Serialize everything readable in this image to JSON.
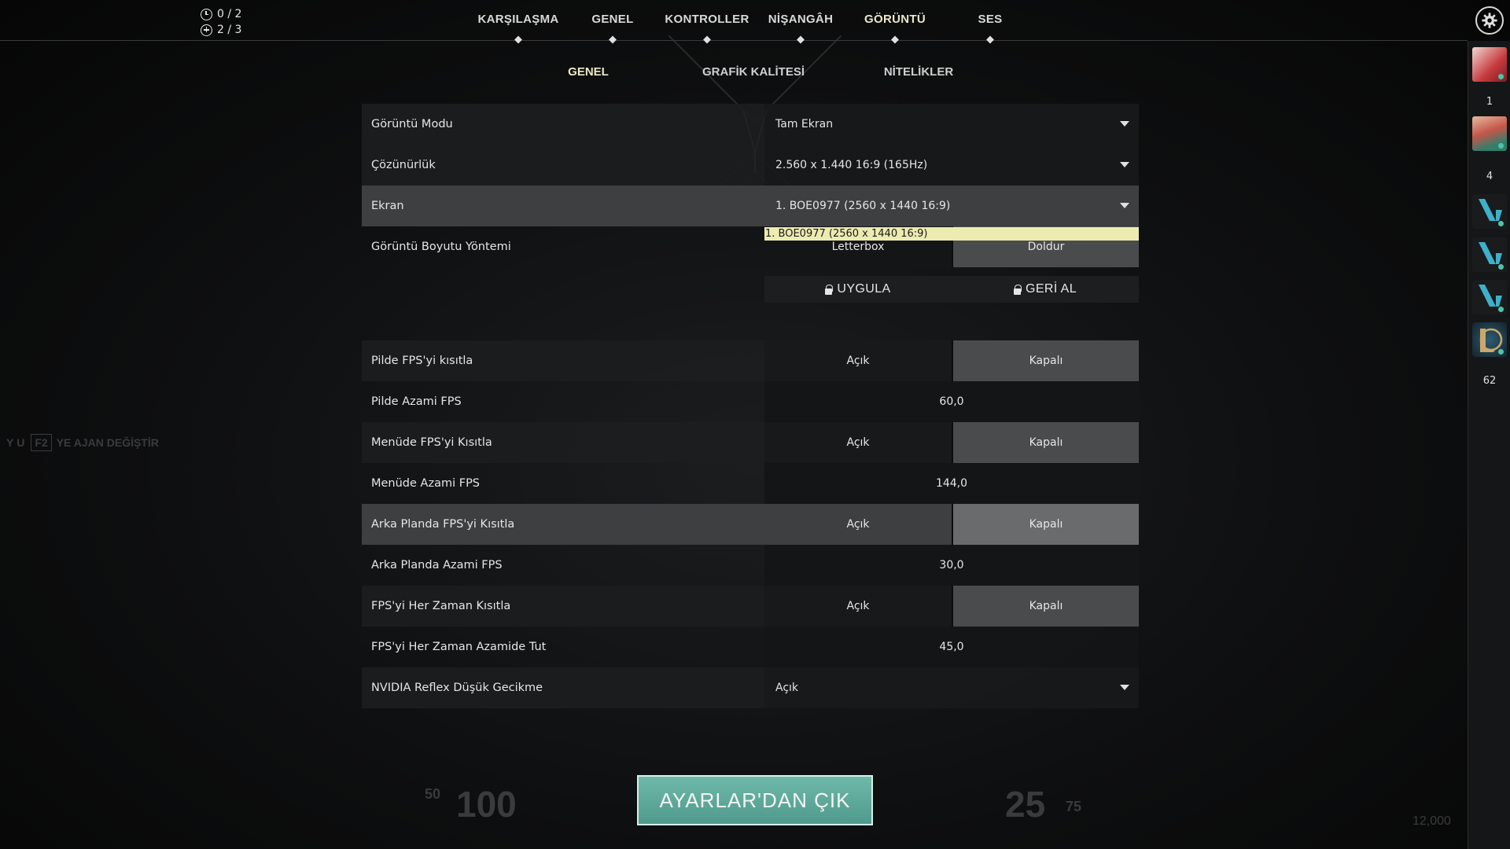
{
  "counters": {
    "timer": "0 / 2",
    "plus": "2 / 3"
  },
  "main_tabs": [
    {
      "label": "KARŞILAŞMA"
    },
    {
      "label": "GENEL"
    },
    {
      "label": "KONTROLLER"
    },
    {
      "label": "NİŞANGÂH"
    },
    {
      "label": "GÖRÜNTÜ",
      "active": true
    },
    {
      "label": "SES"
    }
  ],
  "sub_tabs": [
    {
      "label": "GENEL",
      "active": true
    },
    {
      "label": "GRAFİK KALİTESİ"
    },
    {
      "label": "NİTELİKLER"
    }
  ],
  "sidebar": {
    "counts": [
      "1",
      "4",
      "62"
    ]
  },
  "settings": {
    "display_mode": {
      "label": "Görüntü Modu",
      "value": "Tam Ekran"
    },
    "resolution": {
      "label": "Çözünürlük",
      "value": "2.560 x 1.440 16:9 (165Hz)"
    },
    "monitor": {
      "label": "Ekran",
      "value": "1. BOE0977 (2560 x  1440 16:9)",
      "popup_option": "1. BOE0977 (2560 x  1440 16:9)"
    },
    "aspect_method": {
      "label": "Görüntü Boyutu Yöntemi",
      "opt_a": "Letterbox",
      "opt_b": "Doldur"
    },
    "apply_label": "UYGULA",
    "revert_label": "GERİ AL",
    "limit_fps_battery": {
      "label": "Pilde FPS'yi kısıtla",
      "on": "Açık",
      "off": "Kapalı",
      "selected": "Kapalı"
    },
    "max_fps_battery": {
      "label": "Pilde Azami FPS",
      "value": "60,0"
    },
    "limit_fps_menu": {
      "label": "Menüde FPS'yi Kısıtla",
      "on": "Açık",
      "off": "Kapalı",
      "selected": "Kapalı"
    },
    "max_fps_menu": {
      "label": "Menüde Azami FPS",
      "value": "144,0"
    },
    "limit_fps_background": {
      "label": "Arka Planda FPS'yi Kısıtla",
      "on": "Açık",
      "off": "Kapalı",
      "selected": "Kapalı"
    },
    "max_fps_background": {
      "label": "Arka Planda Azami FPS",
      "value": "30,0"
    },
    "limit_fps_always": {
      "label": "FPS'yi Her Zaman Kısıtla",
      "on": "Açık",
      "off": "Kapalı",
      "selected": "Kapalı"
    },
    "max_fps_always": {
      "label": "FPS'yi Her Zaman Azamide Tut",
      "value": "45,0"
    },
    "nvidia_reflex": {
      "label": "NVIDIA Reflex Düşük Gecikme",
      "value": "Açık"
    }
  },
  "exit_button": {
    "label": "AYARLAR'DAN ÇIK"
  },
  "background_hud": {
    "left_hint": "YE AJAN DEĞİŞTİR",
    "key": "F2",
    "health": "100",
    "shield": "50",
    "ammo": "25",
    "ammo_reserve": "75",
    "credits": "12,000"
  },
  "colors": {
    "accent_active": "#ece8c6",
    "exit_button": "#5fa99b",
    "dropdown_popup": "#ecebb0"
  }
}
